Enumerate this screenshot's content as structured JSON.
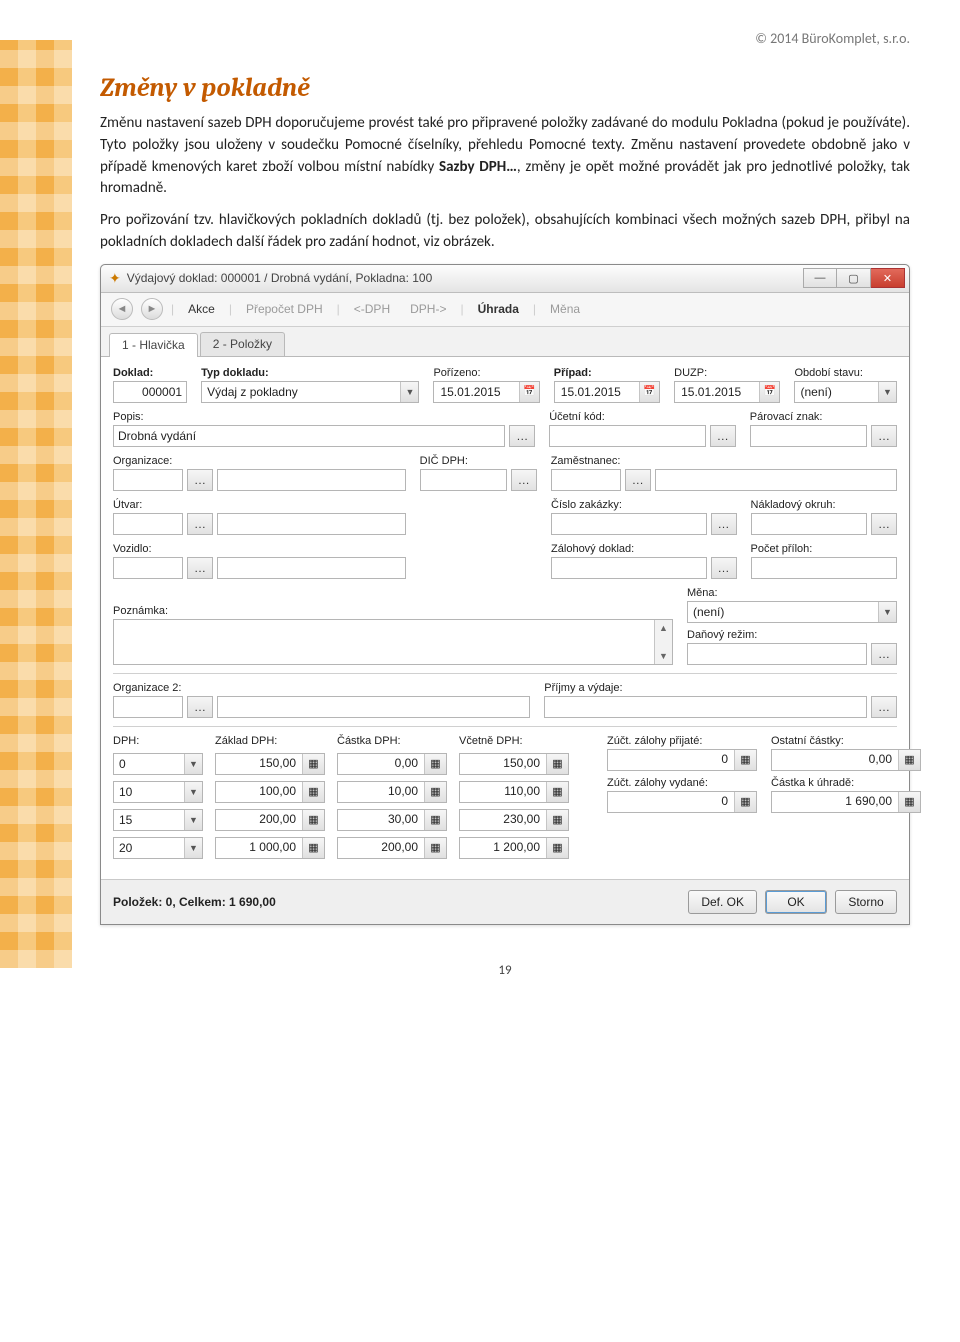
{
  "copyright": "© 2014 BüroKomplet, s.r.o.",
  "section_title": "Změny v pokladně",
  "paragraph_html": "Změnu nastavení sazeb DPH doporučujeme provést také pro připravené položky zadávané do modulu Pokladna (pokud je používáte). Tyto položky jsou uloženy v soudečku Pomocné číselníky, přehledu Pomocné texty. Změnu nastavení provedete obdobně jako v případě kmenových karet zboží volbou místní nabídky <b>Sazby DPH…</b>, změny je opět možné provádět jak pro jednotlivé položky, tak hromadně.",
  "paragraph2": "Pro pořizování tzv. hlavičkových pokladních dokladů (tj. bez položek), obsahujících kombinaci všech možných sazeb DPH, přibyl na pokladních dokladech další řádek pro zadání hodnot, viz obrázek.",
  "window_title": "Výdajový doklad: 000001 / Drobná vydání, Pokladna: 100",
  "toolbar": {
    "akce": "Akce",
    "prep": "Přepočet DPH",
    "dphprev": "<-DPH",
    "dphnext": "DPH->",
    "uhrada": "Úhrada",
    "mena": "Měna"
  },
  "tabs": {
    "t1": "1 - Hlavička",
    "t2": "2 - Položky"
  },
  "labels": {
    "doklad": "Doklad:",
    "typdokladu": "Typ dokladu:",
    "porizeno": "Pořízeno:",
    "pripad": "Případ:",
    "duzp": "DUZP:",
    "obdobi": "Období stavu:",
    "popis": "Popis:",
    "ucetni": "Účetní kód:",
    "par": "Párovací znak:",
    "org": "Organizace:",
    "dic": "DIČ DPH:",
    "zam": "Zaměstnanec:",
    "utvar": "Útvar:",
    "zak": "Číslo zakázky:",
    "nokruh": "Nákladový okruh:",
    "vozidlo": "Vozidlo:",
    "zaloh": "Zálohový doklad:",
    "pril": "Počet příloh:",
    "pozn": "Poznámka:",
    "mena_lbl": "Měna:",
    "drezim": "Daňový režim:",
    "org2": "Organizace 2:",
    "pv": "Příjmy a výdaje:",
    "dph": "DPH:",
    "zaklad": "Základ DPH:",
    "castkadph": "Částka DPH:",
    "vcetne": "Včetně DPH:",
    "zprij": "Zúčt. zálohy přijaté:",
    "ost": "Ostatní částky:",
    "zvyd": "Zúčt. zálohy vydané:",
    "kuhr": "Částka k úhradě:"
  },
  "values": {
    "doklad": "000001",
    "typdokladu": "Výdaj z pokladny",
    "date": "15.01.2015",
    "obdobi": "(není)",
    "popis": "Drobná vydání",
    "mena": "(není)"
  },
  "dph_rows": [
    {
      "rate": "0",
      "base": "150,00",
      "tax": "0,00",
      "incl": "150,00"
    },
    {
      "rate": "10",
      "base": "100,00",
      "tax": "10,00",
      "incl": "110,00"
    },
    {
      "rate": "15",
      "base": "200,00",
      "tax": "30,00",
      "incl": "230,00"
    },
    {
      "rate": "20",
      "base": "1 000,00",
      "tax": "200,00",
      "incl": "1 200,00"
    }
  ],
  "totals": {
    "zprij": "0",
    "ost": "0,00",
    "zvyd": "0",
    "kuhr": "1 690,00"
  },
  "statusbar": {
    "left": "Položek: 0, Celkem: 1 690,00",
    "defok": "Def. OK",
    "ok": "OK",
    "storno": "Storno"
  },
  "page_number": "19"
}
